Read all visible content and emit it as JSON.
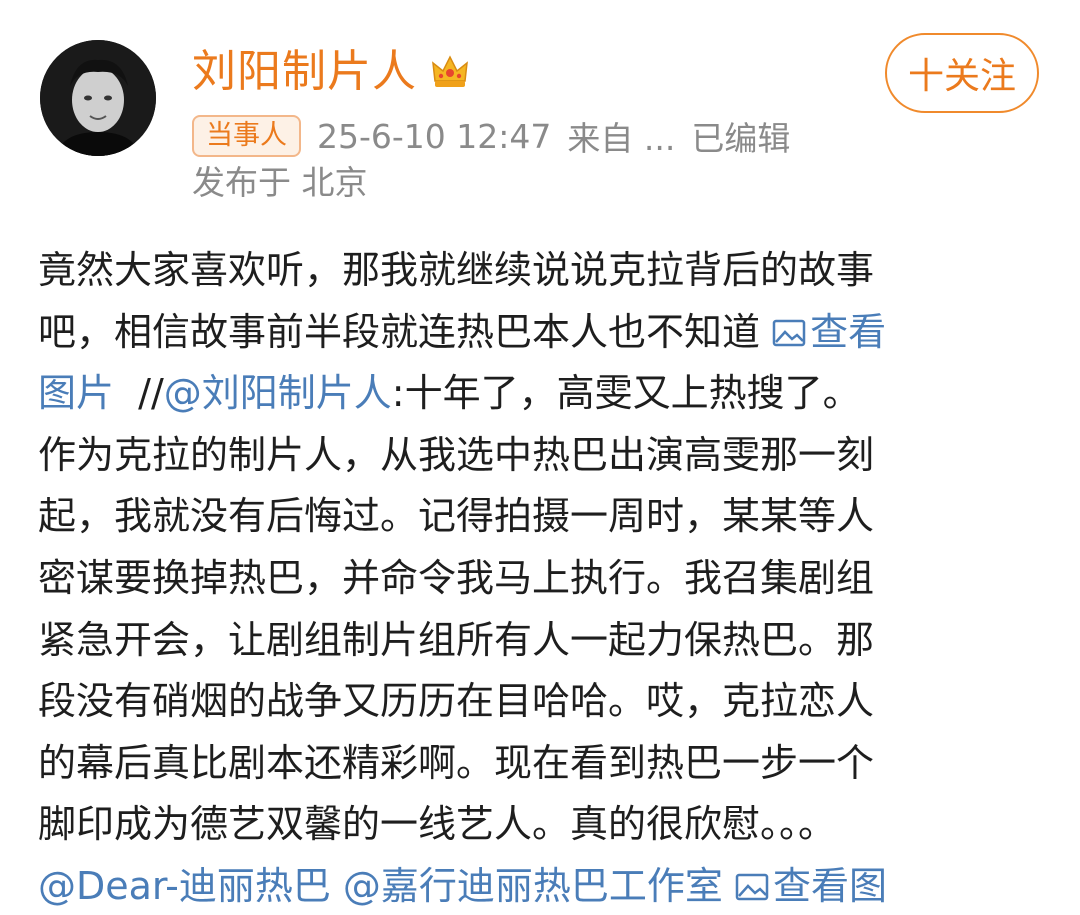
{
  "post": {
    "username": "刘阳制片人",
    "follow_label": "十关注",
    "badge": "当事人",
    "timestamp": "25-6-10 12:47",
    "source": "来自 ...",
    "edited": "已编辑",
    "location": "发布于 北京",
    "body": {
      "l1": "竟然大家喜欢听，那我就继续说说克拉背后的故事",
      "l2a": "吧，相信故事前半段就连热巴本人也不知道 ",
      "l2_link": "查看",
      "l3_link": "图片",
      "l3_spacer": "  //",
      "l3_mention": "@刘阳制片人",
      "l3b": ":十年了，高雯又上热搜了。",
      "l4": "作为克拉的制片人，从我选中热巴出演高雯那一刻",
      "l5": "起，我就没有后悔过。记得拍摄一周时，某某等人",
      "l6": "密谋要换掉热巴，并命令我马上执行。我召集剧组",
      "l7": "紧急开会，让剧组制片组所有人一起力保热巴。那",
      "l8": "段没有硝烟的战争又历历在目哈哈。哎，克拉恋人",
      "l9": "的幕后真比剧本还精彩啊。现在看到热巴一步一个",
      "l10": "脚印成为德艺双馨的一线艺人。真的很欣慰。。。",
      "l11_mention1": "@Dear-迪丽热巴",
      "l11_mention2": " @嘉行迪丽热巴工作室 ",
      "l11_link": "查看图"
    }
  },
  "colors": {
    "username": "#eb7a1d",
    "link": "#4a7db8",
    "meta": "#8a8a8a",
    "text": "#1e1e1e"
  },
  "icons": {
    "avatar": "user-avatar-photo",
    "crown": "crown-icon",
    "image": "image-icon"
  }
}
